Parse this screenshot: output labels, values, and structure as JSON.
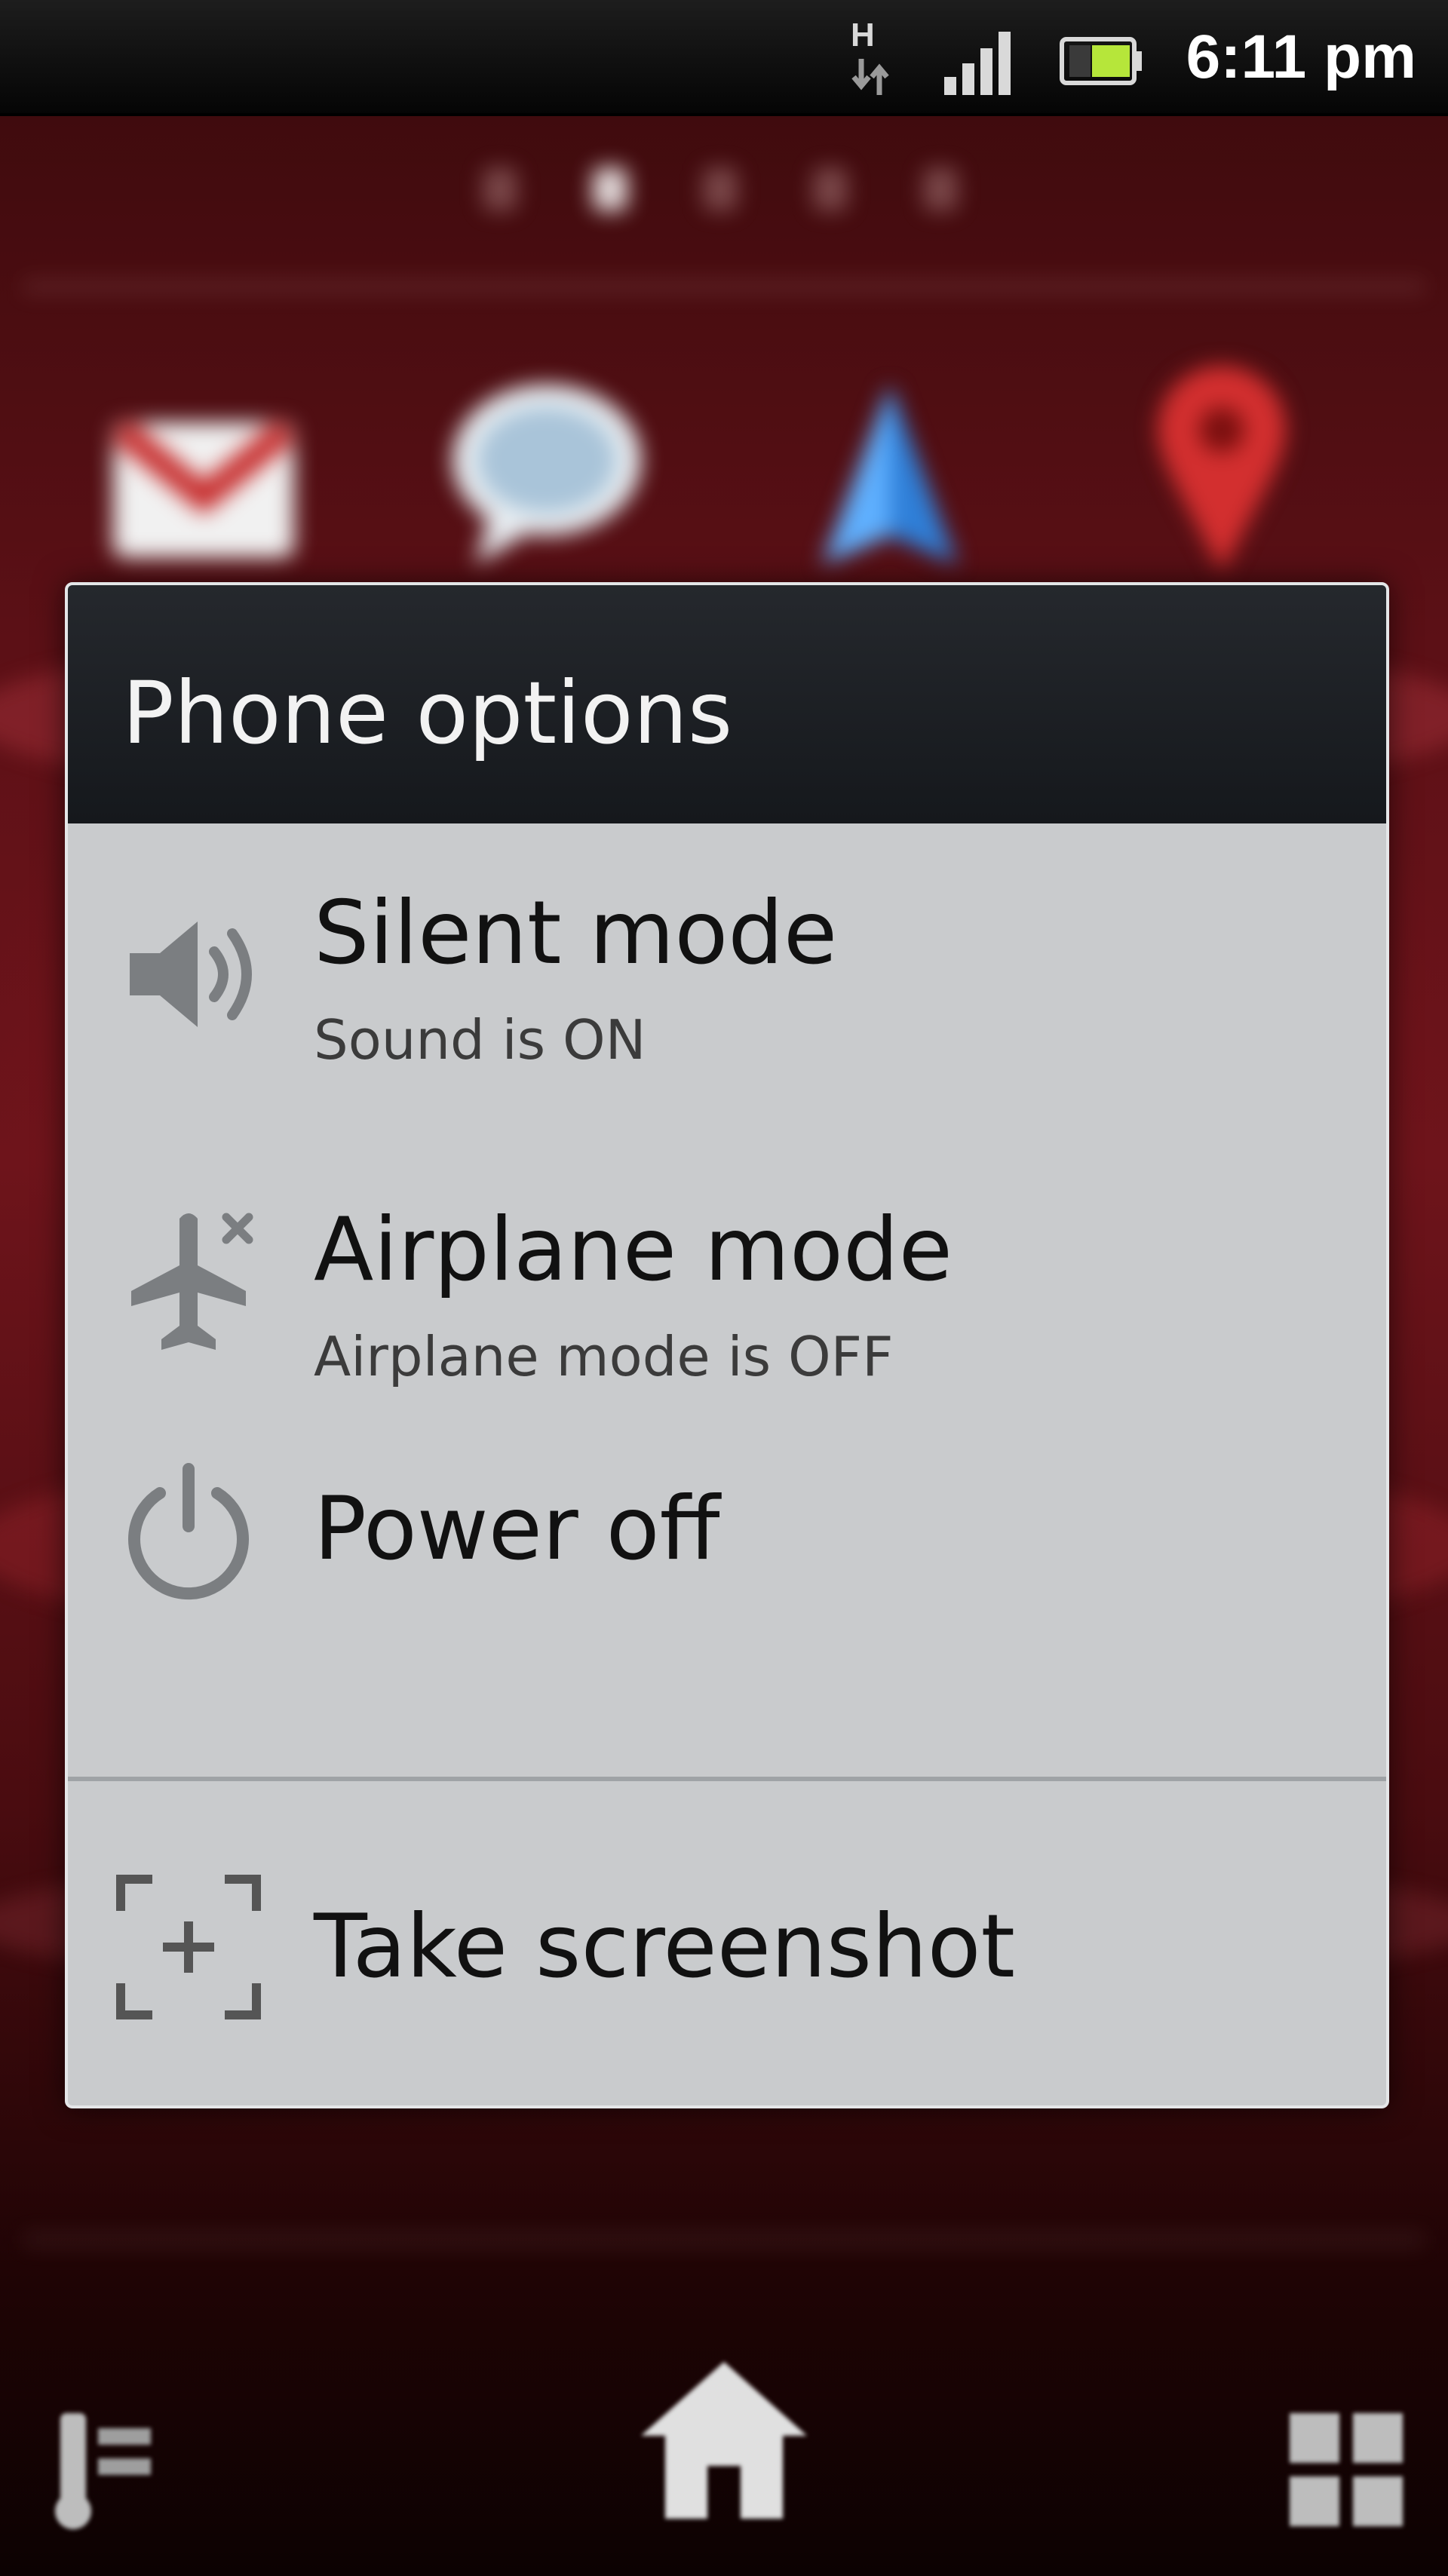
{
  "status_bar": {
    "network_type": "H",
    "time": "6:11 pm",
    "icons": [
      "network-h-icon",
      "signal-icon",
      "battery-icon"
    ]
  },
  "home_screen": {
    "pager": {
      "pages": 5,
      "active_page": 2
    },
    "dock_icons": [
      "applications-icon",
      "home-icon",
      "apps-grid-icon"
    ],
    "background_apps": [
      "gmail-icon",
      "talk-icon",
      "navigation-icon",
      "maps-icon"
    ]
  },
  "dialog": {
    "title": "Phone options",
    "options": [
      {
        "title": "Silent mode",
        "subtitle": "Sound is ON",
        "icon": "speaker-icon"
      },
      {
        "title": "Airplane mode",
        "subtitle": "Airplane mode is OFF",
        "icon": "airplane-icon"
      },
      {
        "title": "Power off",
        "icon": "power-icon"
      },
      {
        "title": "Take screenshot",
        "icon": "screenshot-icon"
      }
    ]
  },
  "colors": {
    "dialog_background": "#c9cbcd",
    "header_background": "#1b1e22",
    "wallpaper_red": "#6e141b"
  }
}
